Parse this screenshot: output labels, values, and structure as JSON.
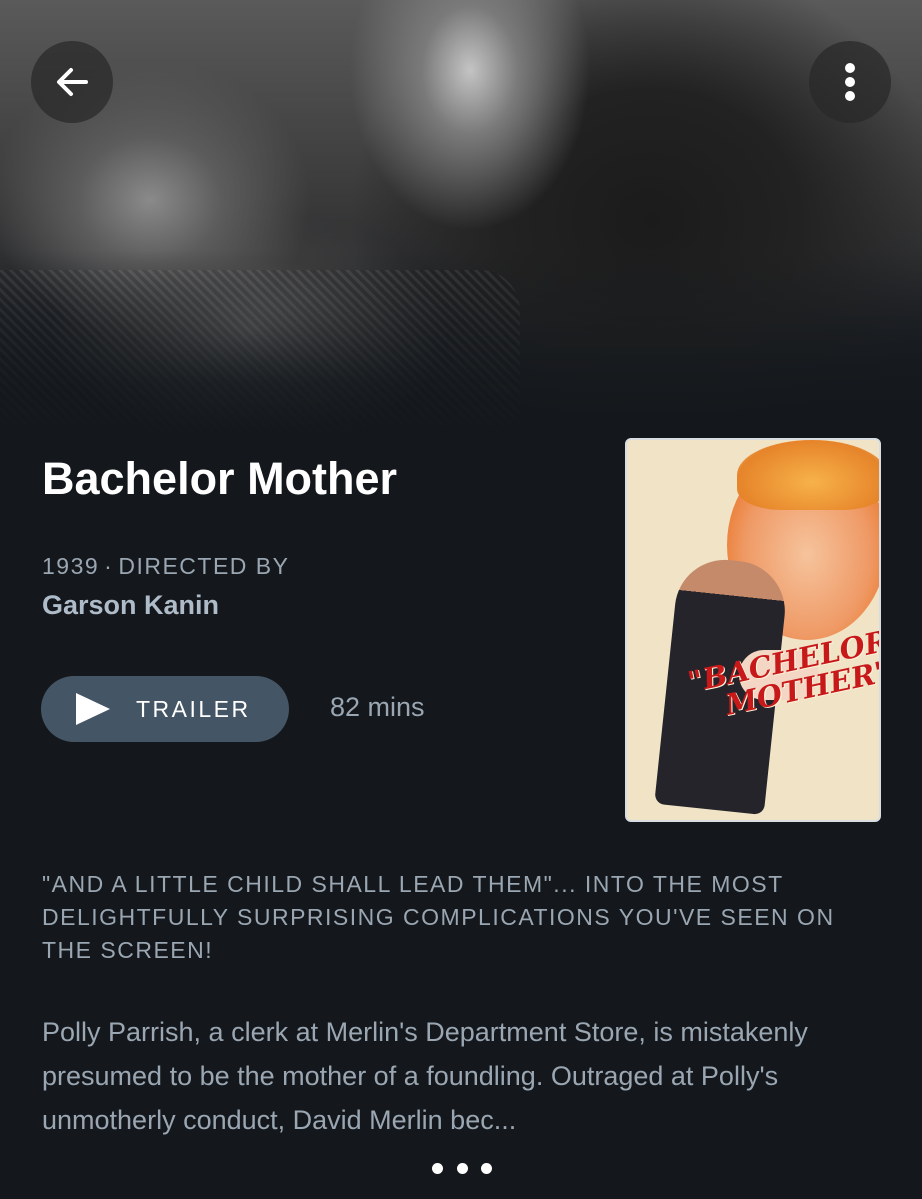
{
  "film": {
    "title": "Bachelor Mother",
    "year": "1939",
    "separator": "·",
    "directed_by_label": "DIRECTED BY",
    "director": "Garson Kanin",
    "runtime": "82 mins",
    "tagline": "\"And a little child shall lead them\"... into the most delightfully surprising complications you've seen on the screen!",
    "synopsis": "Polly Parrish, a clerk at Merlin's Department Store, is mistakenly presumed to be the mother of a foundling. Outraged at Polly's unmotherly conduct, David Merlin bec..."
  },
  "actions": {
    "trailer_label": "TRAILER"
  },
  "poster": {
    "title_line1": "\"BACHELOR",
    "title_line2": "MOTHER\""
  },
  "icons": {
    "back": "arrow-left-icon",
    "more": "more-vertical-icon",
    "play": "play-icon",
    "expand": "more-horizontal-icon"
  },
  "colors": {
    "background": "#14181c",
    "button": "#445566",
    "muted_text": "#9aa6b2"
  }
}
